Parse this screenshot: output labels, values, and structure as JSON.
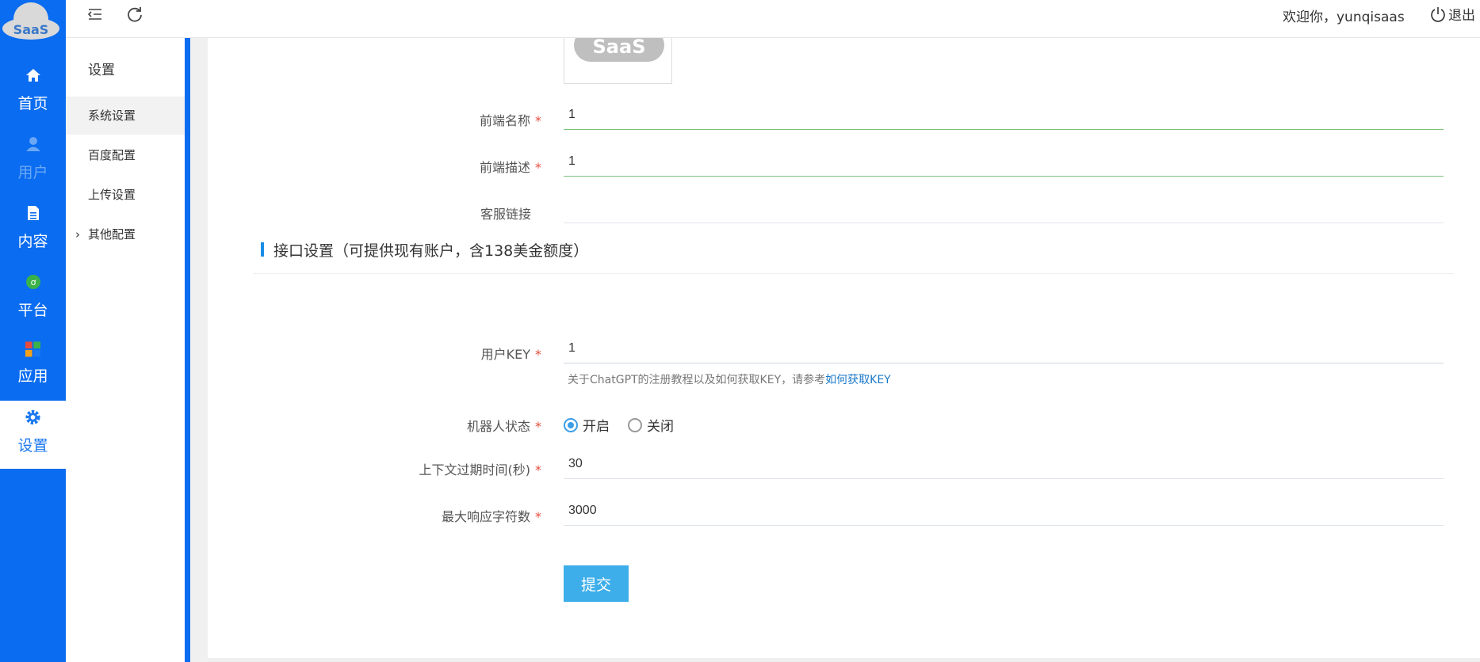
{
  "logo": {
    "text": "SaaS"
  },
  "nav": {
    "items": [
      {
        "label": "首页",
        "icon": "home-icon",
        "state": "normal"
      },
      {
        "label": "用户",
        "icon": "user-icon",
        "state": "dim"
      },
      {
        "label": "内容",
        "icon": "document-icon",
        "state": "normal"
      },
      {
        "label": "平台",
        "icon": "platform-icon",
        "state": "normal"
      },
      {
        "label": "应用",
        "icon": "apps-icon",
        "state": "normal"
      },
      {
        "label": "设置",
        "icon": "gear-icon",
        "state": "active"
      }
    ]
  },
  "submenu": {
    "title": "设置",
    "items": [
      {
        "label": "系统设置",
        "selected": true
      },
      {
        "label": "百度配置",
        "selected": false
      },
      {
        "label": "上传设置",
        "selected": false
      },
      {
        "label": "其他配置",
        "selected": false,
        "expandable": true
      }
    ]
  },
  "header": {
    "menu_icon": "menu-collapse-icon",
    "refresh_icon": "refresh-icon",
    "welcome": "欢迎你，yunqisaas",
    "logout": "退出"
  },
  "form": {
    "logo_preview_text": "SaaS",
    "frontend_name": {
      "label": "前端名称",
      "value": "1",
      "required": true
    },
    "frontend_desc": {
      "label": "前端描述",
      "value": "1",
      "required": true
    },
    "service_link": {
      "label": "客服链接",
      "value": "",
      "required": false
    },
    "section_title": "接口设置（可提供现有账户，含138美金额度）",
    "user_key": {
      "label": "用户KEY",
      "value": "1",
      "required": true
    },
    "hint_text": "关于ChatGPT的注册教程以及如何获取KEY，请参考",
    "hint_link": "如何获取KEY",
    "bot_status": {
      "label": "机器人状态",
      "required": true,
      "options": [
        "开启",
        "关闭"
      ],
      "selected": "开启"
    },
    "context_expire": {
      "label": "上下文过期时间(秒)",
      "value": "30",
      "required": true
    },
    "max_chars": {
      "label": "最大响应字符数",
      "value": "3000",
      "required": true
    },
    "submit_label": "提交"
  },
  "colors": {
    "nav_bg": "#0a6cf0",
    "accent": "#3daeea",
    "required": "#e74c3c"
  }
}
